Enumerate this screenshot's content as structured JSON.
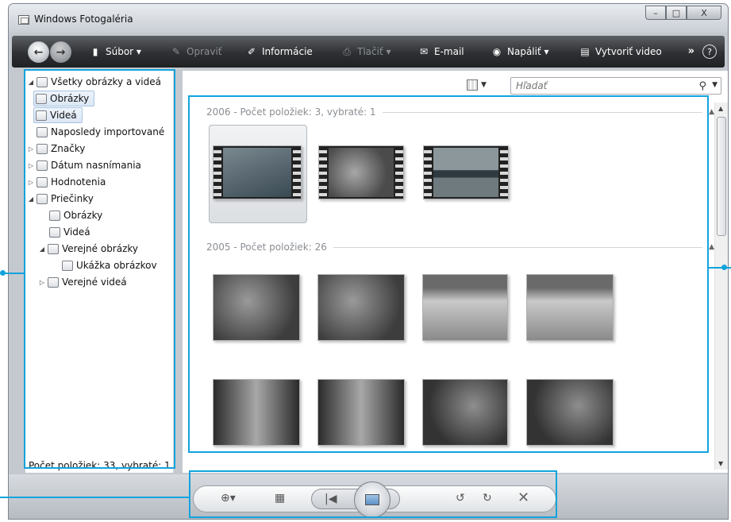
{
  "window": {
    "title": "Windows Fotogaléria",
    "minimize": "–",
    "maximize": "□",
    "close": "X"
  },
  "toolbar": {
    "back": "←",
    "forward": "→",
    "items": [
      {
        "label": "Súbor ▾",
        "icon": "file-icon",
        "glyph": "▮",
        "enabled": true
      },
      {
        "label": "Opraviť",
        "icon": "fix-icon",
        "glyph": "✎",
        "enabled": false
      },
      {
        "label": "Informácie",
        "icon": "info-icon",
        "glyph": "✐",
        "enabled": true
      },
      {
        "label": "Tlačiť ▾",
        "icon": "print-icon",
        "glyph": "⎙",
        "enabled": false
      },
      {
        "label": "E-mail",
        "icon": "email-icon",
        "glyph": "✉",
        "enabled": true
      },
      {
        "label": "Napáliť ▾",
        "icon": "burn-icon",
        "glyph": "◉",
        "enabled": true
      },
      {
        "label": "Vytvoriť video",
        "icon": "movie-icon",
        "glyph": "▤",
        "enabled": true
      }
    ],
    "more": "»",
    "help": "?"
  },
  "nav_pane": {
    "items": [
      {
        "label": "Všetky obrázky a videá",
        "arrow": "◢",
        "icon": "all-photos-icon"
      },
      {
        "label": "Obrázky",
        "arrow": "",
        "icon": "pictures-icon"
      },
      {
        "label": "Videá",
        "arrow": "",
        "icon": "videos-icon"
      },
      {
        "label": "Naposledy importované",
        "arrow": "",
        "icon": "recent-import-icon"
      },
      {
        "label": "Značky",
        "arrow": "▷",
        "icon": "tags-icon"
      },
      {
        "label": "Dátum nasnímania",
        "arrow": "▷",
        "icon": "date-taken-icon"
      },
      {
        "label": "Hodnotenia",
        "arrow": "▷",
        "icon": "ratings-icon"
      },
      {
        "label": "Priečinky",
        "arrow": "◢",
        "icon": "folders-icon"
      },
      {
        "label": "Obrázky",
        "arrow": "",
        "icon": "pictures-folder-icon"
      },
      {
        "label": "Videá",
        "arrow": "",
        "icon": "videos-folder-icon"
      },
      {
        "label": "Verejné obrázky",
        "arrow": "◢",
        "icon": "public-pictures-icon"
      },
      {
        "label": "Ukážka obrázkov",
        "arrow": "",
        "icon": "sample-pictures-icon"
      },
      {
        "label": "Verejné videá",
        "arrow": "▷",
        "icon": "public-videos-icon"
      }
    ],
    "status": "Počet položiek: 33, vybraté: 1"
  },
  "search": {
    "placeholder": "Hľadať",
    "view_icon": "view-mode-icon"
  },
  "groups": [
    {
      "label": "2006 - Počet položiek: 3, vybraté: 1"
    },
    {
      "label": "2005 - Počet položiek: 26"
    }
  ],
  "thumbnails": [
    {
      "group": 0,
      "kind": "video",
      "subject": "dog-in-water",
      "colors": [
        "#3a4a52",
        "#7a8890"
      ]
    },
    {
      "group": 0,
      "kind": "video",
      "subject": "butterfly",
      "colors": [
        "#4b4b4b",
        "#a7a7a7"
      ]
    },
    {
      "group": 0,
      "kind": "video",
      "subject": "lake",
      "colors": [
        "#2f3a40",
        "#8c979c"
      ]
    },
    {
      "group": 1,
      "kind": "photo",
      "subject": "leaves",
      "colors": [
        "#3d3d3d",
        "#9a9a9a"
      ]
    },
    {
      "group": 1,
      "kind": "photo",
      "subject": "leaves",
      "colors": [
        "#3d3d3d",
        "#9a9a9a"
      ]
    },
    {
      "group": 1,
      "kind": "photo",
      "subject": "desert-oryx",
      "colors": [
        "#6a6a6a",
        "#c9c9c9"
      ]
    },
    {
      "group": 1,
      "kind": "photo",
      "subject": "desert-oryx",
      "colors": [
        "#6a6a6a",
        "#c9c9c9"
      ]
    },
    {
      "group": 1,
      "kind": "photo",
      "subject": "forest",
      "colors": [
        "#2b2b2b",
        "#a8a8a8"
      ]
    },
    {
      "group": 1,
      "kind": "photo",
      "subject": "forest",
      "colors": [
        "#2b2b2b",
        "#a8a8a8"
      ]
    },
    {
      "group": 1,
      "kind": "photo",
      "subject": "flowers",
      "colors": [
        "#333333",
        "#8e8e8e"
      ]
    },
    {
      "group": 1,
      "kind": "photo",
      "subject": "flowers",
      "colors": [
        "#333333",
        "#8e8e8e"
      ]
    }
  ],
  "controls": {
    "zoom": "⊕▾",
    "grid": "▦",
    "prev": "|◀",
    "slideshow": "slideshow-icon",
    "next": "▶|",
    "rotate_left": "↺",
    "rotate_right": "↻",
    "delete": "✕"
  },
  "accent": "#12a3dc"
}
